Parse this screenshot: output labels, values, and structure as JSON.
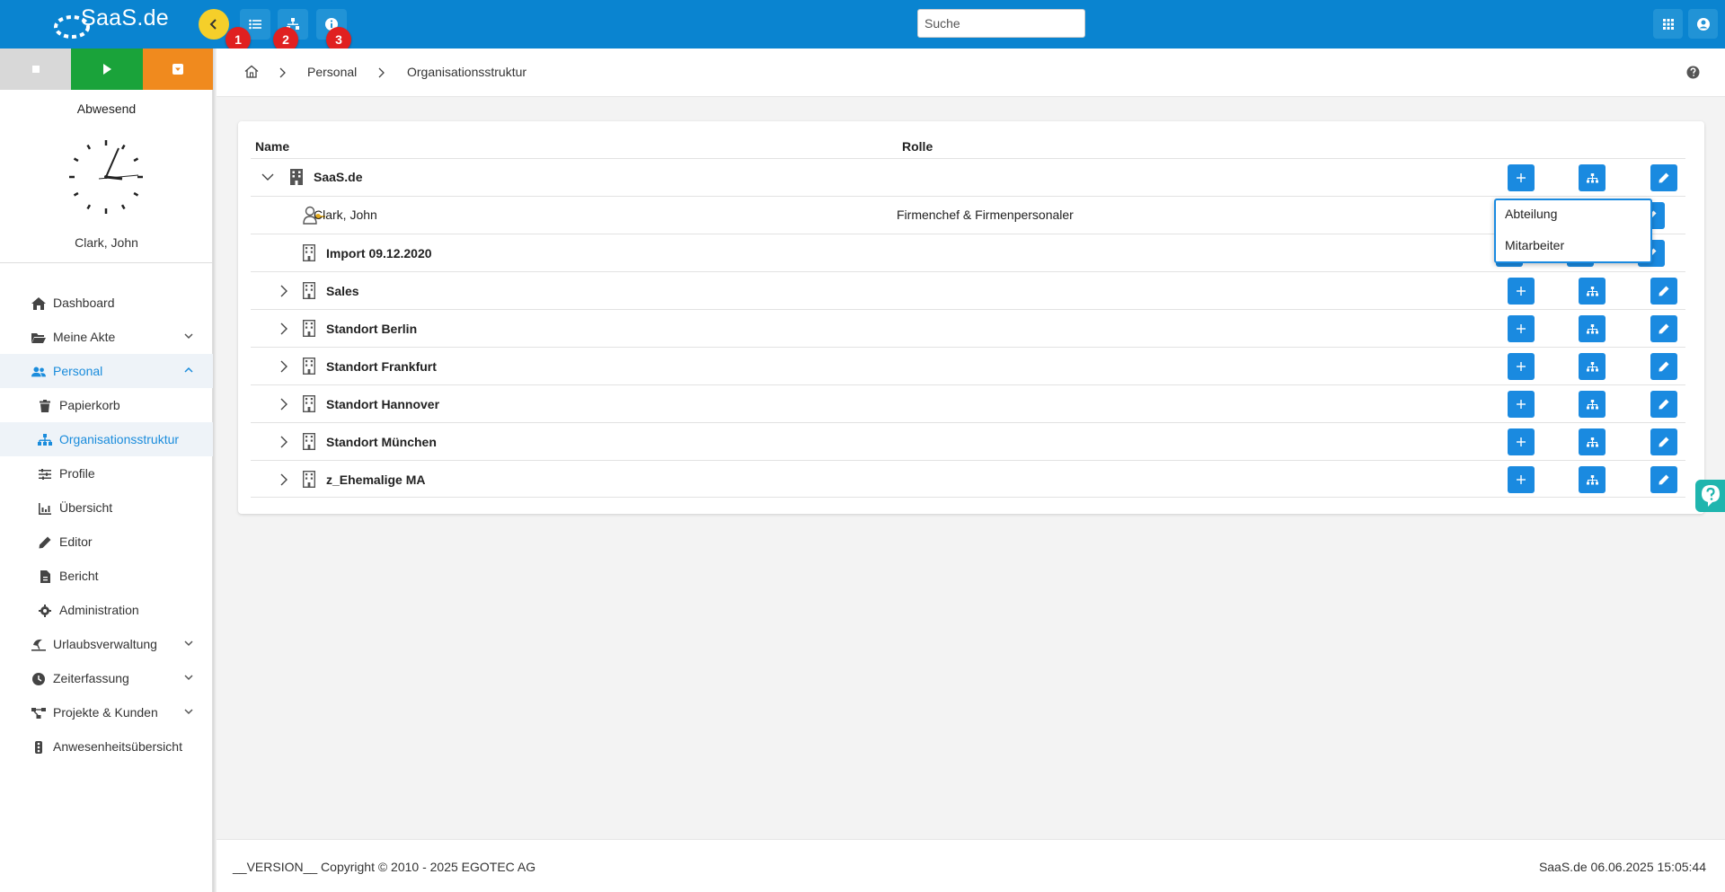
{
  "app": {
    "logo_text": "SaaS.de",
    "brand_color": "#0a84d0"
  },
  "toolbar": {
    "badges": [
      "1",
      "2",
      "3"
    ],
    "search_placeholder": "Suche"
  },
  "sidebar": {
    "status": "Abwesend",
    "user_name": "Clark, John",
    "items": [
      {
        "label": "Dashboard",
        "icon": "home-icon"
      },
      {
        "label": "Meine Akte",
        "icon": "folder-open-icon"
      },
      {
        "label": "Personal",
        "icon": "users-icon"
      },
      {
        "label": "Papierkorb",
        "icon": "trash-icon"
      },
      {
        "label": "Organisationsstruktur",
        "icon": "sitemap-icon"
      },
      {
        "label": "Profile",
        "icon": "sliders-icon"
      },
      {
        "label": "Übersicht",
        "icon": "chart-icon"
      },
      {
        "label": "Editor",
        "icon": "pencil-icon"
      },
      {
        "label": "Bericht",
        "icon": "report-file-icon"
      },
      {
        "label": "Administration",
        "icon": "gear-icon"
      },
      {
        "label": "Urlaubsverwaltung",
        "icon": "umbrella-beach-icon"
      },
      {
        "label": "Zeiterfassung",
        "icon": "clock-icon"
      },
      {
        "label": "Projekte & Kunden",
        "icon": "project-diagram-icon"
      },
      {
        "label": "Anwesenheitsübersicht",
        "icon": "traffic-light-icon"
      }
    ]
  },
  "breadcrumb": {
    "items": [
      "Personal",
      "Organisationsstruktur"
    ]
  },
  "table": {
    "headers": {
      "name": "Name",
      "role": "Rolle"
    },
    "rows": [
      {
        "name": "SaaS.de",
        "role": "",
        "type": "company"
      },
      {
        "name": "Clark, John",
        "role": "Firmenchef & Firmenpersonaler",
        "type": "person"
      },
      {
        "name": "Import 09.12.2020",
        "role": "",
        "type": "department"
      },
      {
        "name": "Sales",
        "role": "",
        "type": "department"
      },
      {
        "name": "Standort Berlin",
        "role": "",
        "type": "department"
      },
      {
        "name": "Standort Frankfurt",
        "role": "",
        "type": "department"
      },
      {
        "name": "Standort Hannover",
        "role": "",
        "type": "department"
      },
      {
        "name": "Standort München",
        "role": "",
        "type": "department"
      },
      {
        "name": "z_Ehemalige MA",
        "role": "",
        "type": "department"
      }
    ]
  },
  "dropdown": {
    "items": [
      "Abteilung",
      "Mitarbeiter"
    ]
  },
  "footer": {
    "copyright": "__VERSION__ Copyright © 2010 - 2025 EGOTEC AG",
    "right": "SaaS.de  06.06.2025 15:05:44"
  },
  "colors": {
    "accent": "#1a8ae0",
    "back_button": "#f5cf2a",
    "badge": "#e02020",
    "stop": "#d8d8d8",
    "play": "#1aa33a",
    "menu": "#f08a1e",
    "help_float": "#1fb5ae"
  }
}
